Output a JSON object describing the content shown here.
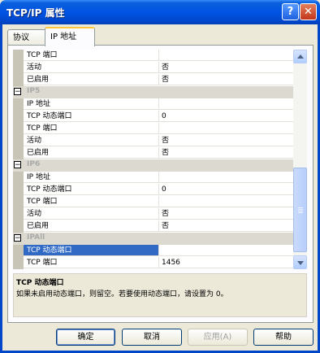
{
  "window": {
    "title": "TCP/IP 属性",
    "help_glyph": "?",
    "close_glyph": "✕"
  },
  "tabs": [
    {
      "label": "协议"
    },
    {
      "label": "IP 地址"
    }
  ],
  "grid": {
    "rows": [
      {
        "name": "TCP 端口",
        "value": ""
      },
      {
        "name": "活动",
        "value": "否"
      },
      {
        "name": "已启用",
        "value": "否"
      },
      {
        "category": "IP5"
      },
      {
        "name": "IP 地址",
        "value": ""
      },
      {
        "name": "TCP 动态端口",
        "value": "0"
      },
      {
        "name": "TCP 端口",
        "value": ""
      },
      {
        "name": "活动",
        "value": "否"
      },
      {
        "name": "已启用",
        "value": "否"
      },
      {
        "category": "IP6"
      },
      {
        "name": "IP 地址",
        "value": ""
      },
      {
        "name": "TCP 动态端口",
        "value": "0"
      },
      {
        "name": "TCP 端口",
        "value": ""
      },
      {
        "name": "活动",
        "value": "否"
      },
      {
        "name": "已启用",
        "value": "否"
      },
      {
        "category": "IPAll"
      },
      {
        "name": "TCP 动态端口",
        "value": "",
        "selected": true
      },
      {
        "name": "TCP 端口",
        "value": "1456"
      }
    ]
  },
  "description": {
    "title": "TCP 动态端口",
    "text": "如果未启用动态端口，则留空。若要使用动态端口，请设置为 0。"
  },
  "buttons": {
    "ok": "确定",
    "cancel": "取消",
    "apply": "应用(A)",
    "help": "帮助"
  }
}
